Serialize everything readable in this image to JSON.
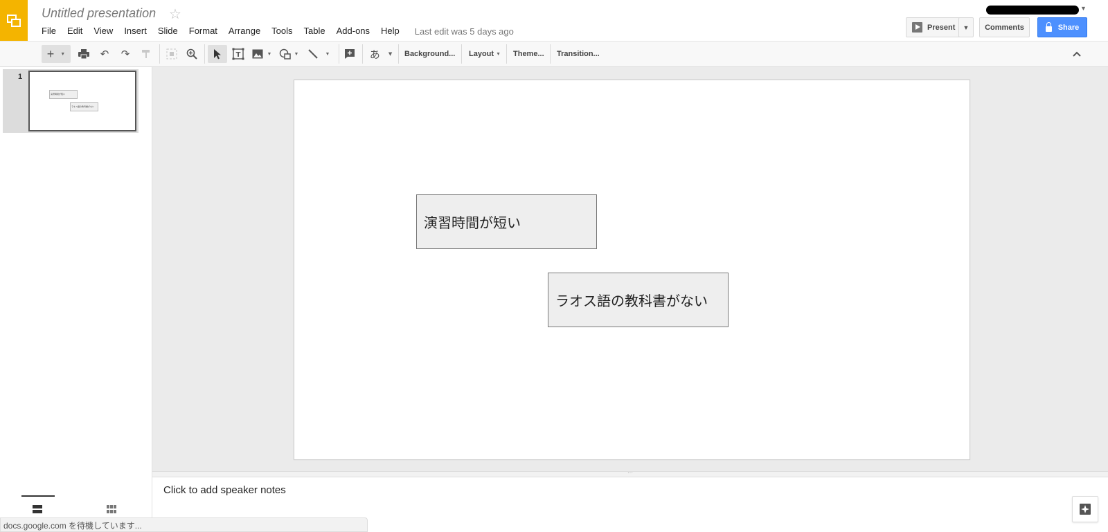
{
  "doc": {
    "title": "Untitled presentation",
    "last_edit": "Last edit was 5 days ago"
  },
  "menu": [
    "File",
    "Edit",
    "View",
    "Insert",
    "Slide",
    "Format",
    "Arrange",
    "Tools",
    "Table",
    "Add-ons",
    "Help"
  ],
  "header_buttons": {
    "present": "Present",
    "comments": "Comments",
    "share": "Share"
  },
  "toolbar": {
    "input_tools_glyph": "あ",
    "background": "Background...",
    "layout": "Layout",
    "theme": "Theme...",
    "transition": "Transition..."
  },
  "filmstrip": {
    "slides": [
      {
        "number": "1",
        "boxes": [
          "演習時間が短い",
          "ラオス語の教科書がない"
        ]
      }
    ]
  },
  "slide": {
    "textboxes": [
      "演習時間が短い",
      "ラオス語の教科書がない"
    ]
  },
  "notes": {
    "placeholder": "Click to add speaker notes"
  },
  "status": "docs.google.com を待機しています...",
  "colors": {
    "brand": "#f4b400",
    "share": "#4d90fe",
    "workspace": "#ebebeb",
    "textbox_fill": "#eeeeee"
  },
  "icons": [
    "slides-logo-icon",
    "star-icon",
    "present-play-icon",
    "lock-icon",
    "new-slide-icon",
    "print-icon",
    "undo-icon",
    "redo-icon",
    "paint-format-icon",
    "zoom-fit-icon",
    "zoom-icon",
    "select-icon",
    "textbox-icon",
    "image-icon",
    "shape-icon",
    "line-icon",
    "comment-icon",
    "collapse-icon",
    "explore-icon"
  ]
}
